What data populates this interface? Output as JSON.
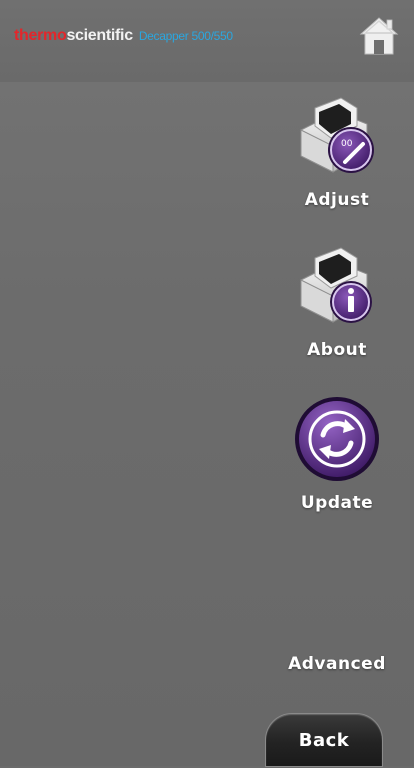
{
  "header": {
    "brand_thermo": "thermo",
    "brand_scientific": "scientific",
    "product": "Decapper 500/550",
    "home_icon": "home-icon"
  },
  "menu": {
    "adjust": {
      "label": "Adjust",
      "icon": "decapper-adjust-icon"
    },
    "about": {
      "label": "About",
      "icon": "decapper-info-icon"
    },
    "update": {
      "label": "Update",
      "icon": "refresh-icon"
    }
  },
  "advanced_label": "Advanced",
  "back_label": "Back",
  "colors": {
    "background": "#6b6b6b",
    "brand_red": "#e3262b",
    "brand_blue": "#2aa7e0",
    "accent_purple": "#5a2d82",
    "label_white": "#ffffff"
  }
}
